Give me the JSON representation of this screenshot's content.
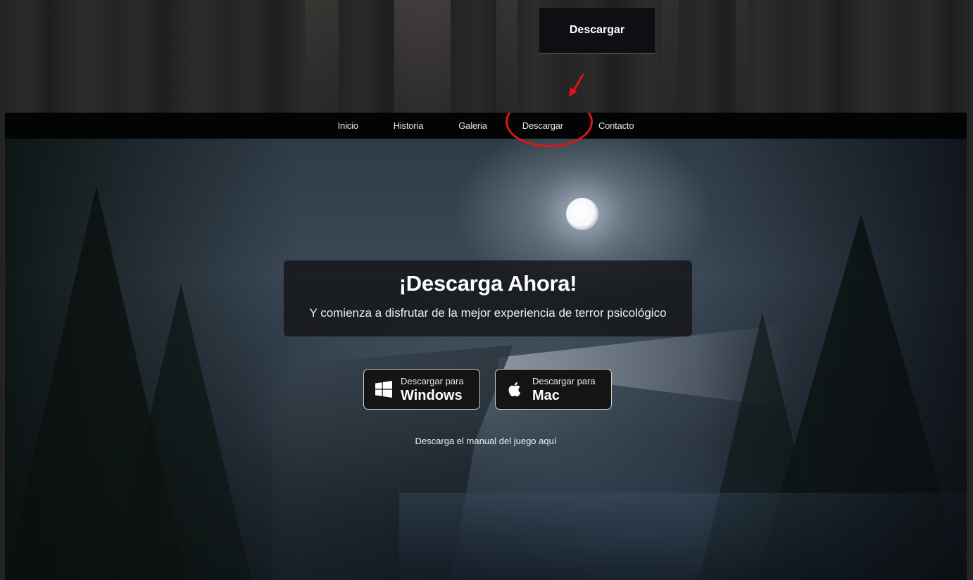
{
  "callout": {
    "label": "Descargar"
  },
  "nav": {
    "items": [
      "Inicio",
      "Historia",
      "Galeria",
      "Descargar",
      "Contacto"
    ],
    "highlighted": "Descargar"
  },
  "hero": {
    "title": "¡Descarga Ahora!",
    "subtitle": "Y comienza a disfrutar de la mejor experiencia de terror psicológico"
  },
  "downloads": {
    "windows": {
      "small_label": "Descargar para",
      "platform": "Windows",
      "icon": "windows-logo-icon"
    },
    "mac": {
      "small_label": "Descargar para",
      "platform": "Mac",
      "icon": "apple-logo-icon"
    }
  },
  "manual_link": "Descarga el manual del juego aquí",
  "colors": {
    "annotation_red": "#e01414",
    "navbar_bg": "#030404",
    "button_bg": "#141414"
  }
}
